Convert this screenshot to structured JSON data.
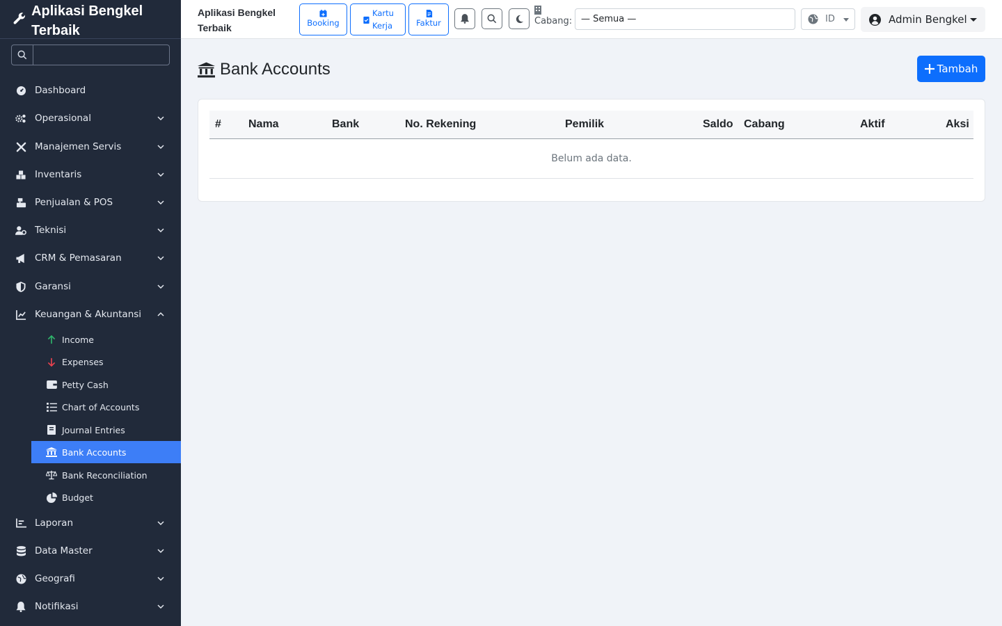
{
  "app": {
    "name": "Aplikasi Bengkel Terbaik"
  },
  "sidebar": {
    "search_placeholder": "",
    "items": [
      {
        "label": "Dashboard",
        "icon": "gauge-icon"
      },
      {
        "label": "Operasional",
        "icon": "gears-icon"
      },
      {
        "label": "Manajemen Servis",
        "icon": "tools-icon"
      },
      {
        "label": "Inventaris",
        "icon": "boxes-icon"
      },
      {
        "label": "Penjualan & POS",
        "icon": "cash-register-icon"
      },
      {
        "label": "Teknisi",
        "icon": "user-gear-icon"
      },
      {
        "label": "CRM & Pemasaran",
        "icon": "bullhorn-icon"
      },
      {
        "label": "Garansi",
        "icon": "shield-icon"
      },
      {
        "label": "Keuangan & Akuntansi",
        "icon": "chart-line-icon",
        "expanded": true
      },
      {
        "label": "Laporan",
        "icon": "chart-bar-icon"
      },
      {
        "label": "Data Master",
        "icon": "database-icon"
      },
      {
        "label": "Geografi",
        "icon": "globe-icon"
      },
      {
        "label": "Notifikasi",
        "icon": "bell-icon"
      }
    ],
    "finance_sub": [
      {
        "label": "Income",
        "icon": "arrow-up-icon",
        "color": "#198754"
      },
      {
        "label": "Expenses",
        "icon": "arrow-down-icon",
        "color": "#dc3545"
      },
      {
        "label": "Petty Cash",
        "icon": "wallet-icon"
      },
      {
        "label": "Chart of Accounts",
        "icon": "list-ol-icon"
      },
      {
        "label": "Journal Entries",
        "icon": "book-icon"
      },
      {
        "label": "Bank Accounts",
        "icon": "bank-icon",
        "active": true
      },
      {
        "label": "Bank Reconciliation",
        "icon": "scale-balanced-icon"
      },
      {
        "label": "Budget",
        "icon": "chart-pie-icon"
      }
    ]
  },
  "topbar": {
    "title": "Aplikasi Bengkel Terbaik",
    "quick": [
      {
        "label": "Booking",
        "icon": "calendar-plus-icon"
      },
      {
        "label": "Kartu Kerja",
        "icon": "clipboard-check-icon"
      },
      {
        "label": "Faktur",
        "icon": "file-invoice-icon"
      }
    ],
    "cabang_label": "Cabang:",
    "cabang_value": "— Semua —",
    "lang_value": "ID",
    "user_name": "Admin Bengkel"
  },
  "page": {
    "title": "Bank Accounts",
    "add_label": "Tambah",
    "columns": [
      "#",
      "Nama",
      "Bank",
      "No. Rekening",
      "Pemilik",
      "Saldo",
      "Cabang",
      "Aktif",
      "Aksi"
    ],
    "empty_text": "Belum ada data."
  },
  "colors": {
    "primary": "#0d6efd",
    "sidebar_bg": "#212a3a",
    "active_item": "#3d7ef7"
  }
}
